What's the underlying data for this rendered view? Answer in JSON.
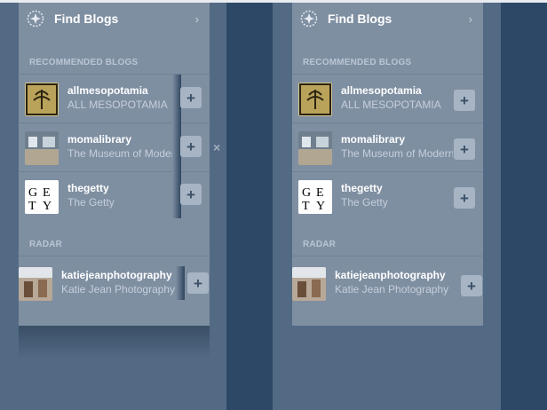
{
  "colors": {
    "bg": "#536a85",
    "panel": "#7f8fa2",
    "dark": "#2c4866",
    "accent_btn": "#a7b4c3"
  },
  "find_blogs": {
    "label": "Find Blogs",
    "icon": "compass-icon",
    "chevron": "›"
  },
  "sections": {
    "recommended": "RECOMMENDED BLOGS",
    "radar": "RADAR"
  },
  "close_glyph": "×",
  "plus_glyph": "+",
  "left": {
    "recommended": [
      {
        "name": "allmesopotamia",
        "title": "ALL MESOPOTAMIA",
        "avatar": "mesopotamia-avatar"
      },
      {
        "name": "momalibrary",
        "title": "The Museum of Modern",
        "avatar": "moma-avatar"
      },
      {
        "name": "thegetty",
        "title": "The Getty",
        "avatar": "getty-avatar"
      }
    ],
    "radar": [
      {
        "name": "katiejeanphotography",
        "title": "Katie Jean Photography",
        "avatar": "katie-avatar"
      }
    ]
  },
  "right": {
    "recommended": [
      {
        "name": "allmesopotamia",
        "title": "ALL MESOPOTAMIA",
        "avatar": "mesopotamia-avatar"
      },
      {
        "name": "momalibrary",
        "title": "The Museum of Modern",
        "avatar": "moma-avatar"
      },
      {
        "name": "thegetty",
        "title": "The Getty",
        "avatar": "getty-avatar"
      }
    ],
    "radar": [
      {
        "name": "katiejeanphotography",
        "title": "Katie Jean Photography",
        "avatar": "katie-avatar"
      }
    ]
  }
}
